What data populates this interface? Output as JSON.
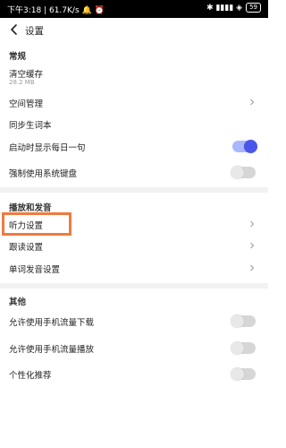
{
  "status_bar": {
    "left_text": "下午3:18 | 61.7K/s 🔔 ⏰",
    "right_text": "✱ ▮▮▮▮ ◈",
    "battery": "59"
  },
  "header": {
    "title": "设置"
  },
  "sections": {
    "general": {
      "title": "常规",
      "clear_cache": {
        "label": "清空缓存",
        "sub": "28.2 MB"
      },
      "space_manage": {
        "label": "空间管理"
      },
      "sync_vocab": {
        "label": "同步生词本"
      },
      "daily_sentence": {
        "label": "启动时显示每日一句",
        "on": true
      },
      "force_keyboard": {
        "label": "强制使用系统键盘",
        "on": false
      }
    },
    "playback": {
      "title": "播放和发音",
      "listening": {
        "label": "听力设置"
      },
      "follow_read": {
        "label": "跟读设置"
      },
      "word_pronunciation": {
        "label": "单词发音设置"
      }
    },
    "other": {
      "title": "其他",
      "mobile_download": {
        "label": "允许使用手机流量下载",
        "on": false
      },
      "mobile_play": {
        "label": "允许使用手机流量播放",
        "on": false
      },
      "personalized": {
        "label": "个性化推荐",
        "on": false
      }
    }
  },
  "colors": {
    "accent": "#4a56ea",
    "highlight": "#f07b3f"
  }
}
